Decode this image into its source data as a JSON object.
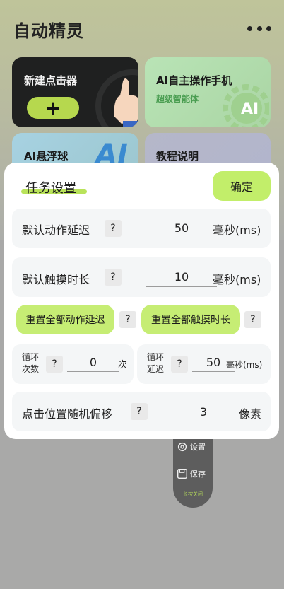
{
  "app": {
    "title": "自动精灵"
  },
  "cards": {
    "new_clicker": {
      "label": "新建点击器",
      "plus": "+"
    },
    "ai_operate": {
      "label": "AI自主操作手机",
      "sub": "超级智能体",
      "badge": "AI"
    },
    "ai_float": {
      "label": "AI悬浮球",
      "badge": "AI"
    },
    "tutorial": {
      "label": "教程说明"
    }
  },
  "floating_panel": {
    "settings_label": "设置",
    "save_label": "保存",
    "hint": "长按关闭"
  },
  "dialog": {
    "title": "任务设置",
    "confirm": "确定",
    "help": "?",
    "default_delay": {
      "label": "默认动作延迟",
      "value": "50",
      "unit": "毫秒(ms)"
    },
    "default_touch": {
      "label": "默认触摸时长",
      "value": "10",
      "unit": "毫秒(ms)"
    },
    "reset_delay": "重置全部动作延迟",
    "reset_touch": "重置全部触摸时长",
    "loop_count": {
      "label_line1": "循环",
      "label_line2": "次数",
      "value": "0",
      "unit": "次"
    },
    "loop_delay": {
      "label_line1": "循环",
      "label_line2": "延迟",
      "value": "50",
      "unit": "毫秒(ms)"
    },
    "random_offset": {
      "label": "点击位置随机偏移",
      "value": "3",
      "unit": "像素"
    }
  },
  "colors": {
    "accent": "#c2ee6a",
    "dark_card": "#1f2020",
    "ai_card": "#b9e4b6"
  }
}
